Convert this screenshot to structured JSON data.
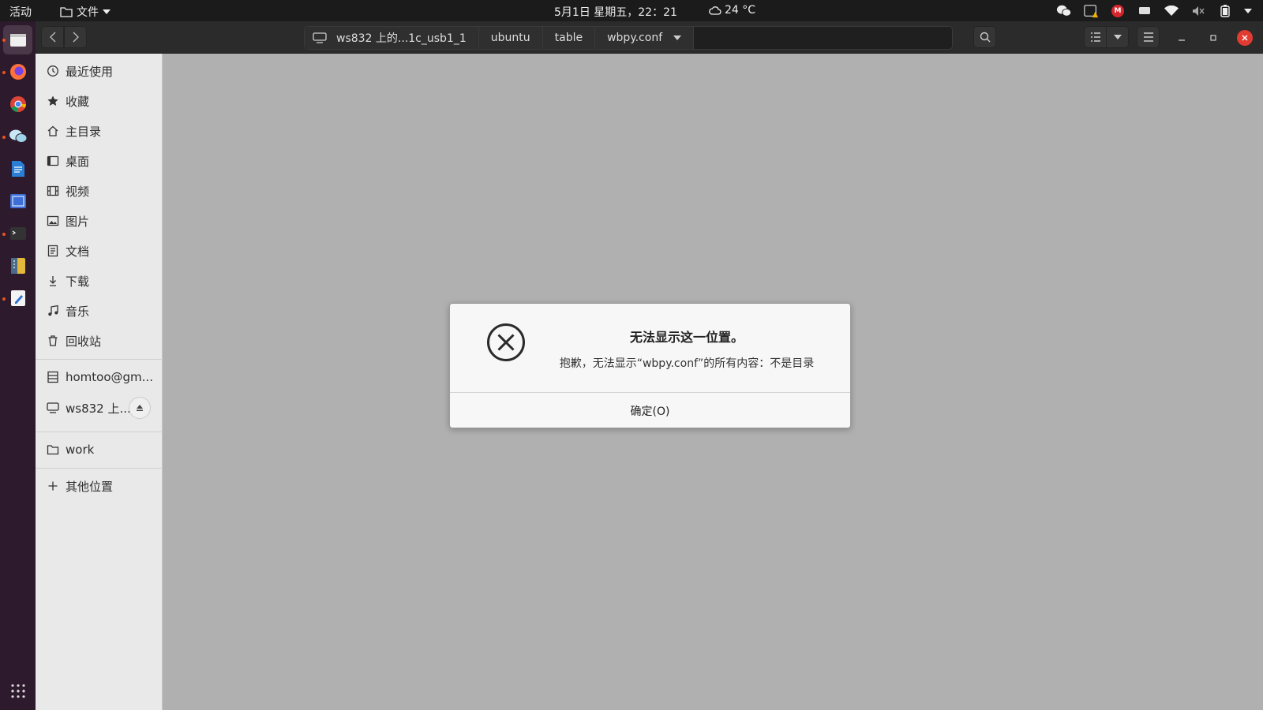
{
  "topbar": {
    "activities": "活动",
    "app_menu": "文件",
    "clock": "5月1日 星期五，22：21",
    "weather": "24 °C",
    "colors": {
      "bar": "#1b1b1b",
      "mail_badge": "#d6262c"
    },
    "mail_badge_letter": "M"
  },
  "dock": {
    "apps": [
      "files",
      "firefox",
      "chrome",
      "wechat",
      "libreoffice-writer",
      "screenshot",
      "terminal",
      "archive-manager",
      "text-editor"
    ],
    "colors": {
      "background": "#2d1a2c",
      "running_dot": "#e95420"
    }
  },
  "pathbar": {
    "crumbs": [
      "ws832 上的...1c_usb1_1",
      "ubuntu",
      "table",
      "wbpy.conf"
    ]
  },
  "sidebar": {
    "items": [
      {
        "label": "最近使用",
        "icon": "clock-icon"
      },
      {
        "label": "收藏",
        "icon": "star-icon"
      },
      {
        "label": "主目录",
        "icon": "home-icon"
      },
      {
        "label": "桌面",
        "icon": "desktop-icon"
      },
      {
        "label": "视频",
        "icon": "film-icon"
      },
      {
        "label": "图片",
        "icon": "image-icon"
      },
      {
        "label": "文档",
        "icon": "document-icon"
      },
      {
        "label": "下载",
        "icon": "download-icon"
      },
      {
        "label": "音乐",
        "icon": "music-icon"
      },
      {
        "label": "回收站",
        "icon": "trash-icon"
      }
    ],
    "remote": [
      {
        "label": "homtoo@gm...",
        "icon": "server-icon"
      },
      {
        "label": "ws832 上...",
        "icon": "network-drive-icon"
      }
    ],
    "bookmarks": [
      {
        "label": "work",
        "icon": "folder-icon"
      }
    ],
    "other": {
      "label": "其他位置",
      "icon": "plus-icon"
    }
  },
  "dialog": {
    "title": "无法显示这一位置。",
    "message": "抱歉，无法显示“wbpy.conf”的所有内容：不是目录",
    "ok_label": "确定(O)",
    "icon": "error-circle-x-icon"
  },
  "colors": {
    "main_bg": "#b0b0b0",
    "header": "#2b2b2b",
    "sidebar": "#e9e9e9",
    "close": "#e03c31"
  }
}
